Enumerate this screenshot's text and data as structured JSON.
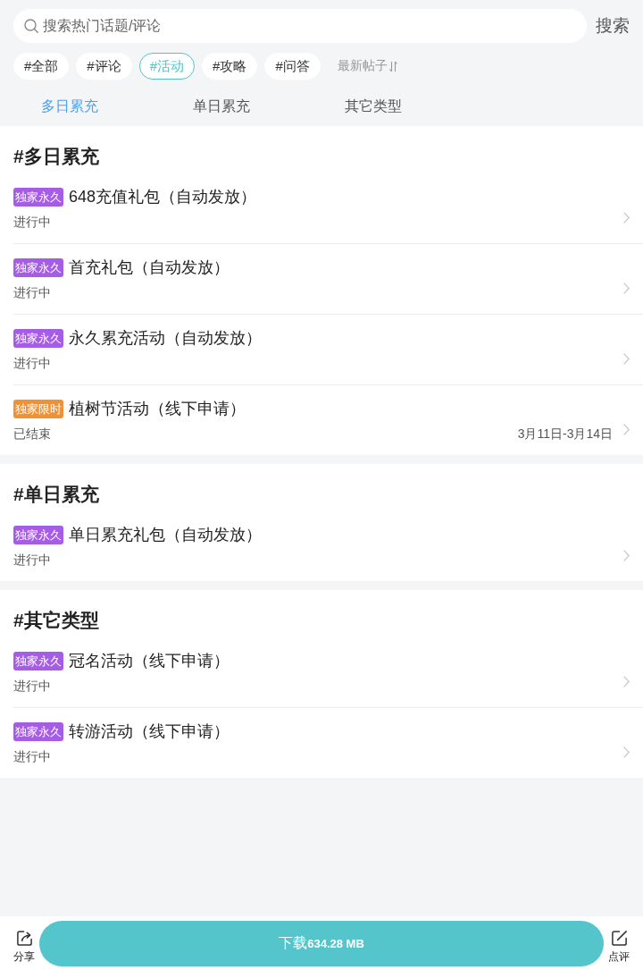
{
  "search": {
    "placeholder": "搜索热门话题/评论",
    "button": "搜索"
  },
  "tags": [
    {
      "label": "#全部",
      "selected": false
    },
    {
      "label": "#评论",
      "selected": false
    },
    {
      "label": "#活动",
      "selected": true
    },
    {
      "label": "#攻略",
      "selected": false
    },
    {
      "label": "#问答",
      "selected": false
    }
  ],
  "sort": {
    "label": "最新帖子"
  },
  "tabs": [
    {
      "label": "多日累充",
      "selected": true
    },
    {
      "label": "单日累充",
      "selected": false
    },
    {
      "label": "其它类型",
      "selected": false
    }
  ],
  "sections": [
    {
      "title": "#多日累充",
      "items": [
        {
          "badge": {
            "text": "独家永久",
            "color": "#a65de6"
          },
          "title": "648充值礼包（自动发放）",
          "status": "进行中"
        },
        {
          "badge": {
            "text": "独家永久",
            "color": "#a65de6"
          },
          "title": "首充礼包（自动发放）",
          "status": "进行中"
        },
        {
          "badge": {
            "text": "独家永久",
            "color": "#a65de6"
          },
          "title": "永久累充活动（自动发放）",
          "status": "进行中"
        },
        {
          "badge": {
            "text": "独家限时",
            "color": "#ef9233"
          },
          "title": "植树节活动（线下申请）",
          "status": "已结束",
          "date_range": "3月11日-3月14日"
        }
      ]
    },
    {
      "title": "#单日累充",
      "items": [
        {
          "badge": {
            "text": "独家永久",
            "color": "#a65de6"
          },
          "title": "单日累充礼包（自动发放）",
          "status": "进行中"
        }
      ]
    },
    {
      "title": "#其它类型",
      "items": [
        {
          "badge": {
            "text": "独家永久",
            "color": "#a65de6"
          },
          "title": "冠名活动（线下申请）",
          "status": "进行中"
        },
        {
          "badge": {
            "text": "独家永久",
            "color": "#a65de6"
          },
          "title": "转游活动（线下申请）",
          "status": "进行中"
        }
      ]
    }
  ],
  "bottom_bar": {
    "share": "分享",
    "download": {
      "label": "下载",
      "size": "634.28 MB"
    },
    "review": "点评"
  }
}
